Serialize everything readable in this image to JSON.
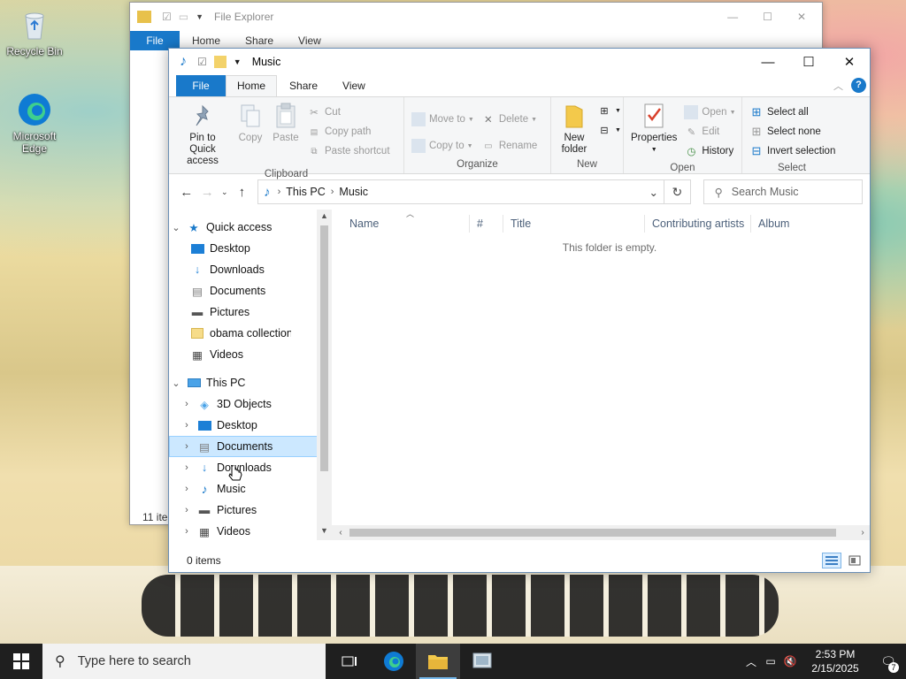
{
  "desktop": {
    "icons": [
      {
        "label": "Recycle Bin"
      },
      {
        "label": "Microsoft Edge"
      }
    ]
  },
  "back_window": {
    "title": "File Explorer",
    "tabs": [
      "File",
      "Home",
      "Share",
      "View"
    ],
    "status": "11 ite"
  },
  "window": {
    "title": "Music",
    "tabs": {
      "file": "File",
      "home": "Home",
      "share": "Share",
      "view": "View"
    },
    "ribbon": {
      "clipboard": {
        "label": "Clipboard",
        "pin": "Pin to Quick access",
        "copy": "Copy",
        "paste": "Paste",
        "cut": "Cut",
        "copy_path": "Copy path",
        "paste_shortcut": "Paste shortcut"
      },
      "organize": {
        "label": "Organize",
        "move_to": "Move to",
        "copy_to": "Copy to",
        "delete": "Delete",
        "rename": "Rename"
      },
      "new": {
        "label": "New",
        "new_folder": "New folder"
      },
      "open": {
        "label": "Open",
        "properties": "Properties",
        "open": "Open",
        "edit": "Edit",
        "history": "History"
      },
      "select": {
        "label": "Select",
        "select_all": "Select all",
        "select_none": "Select none",
        "invert": "Invert selection"
      }
    },
    "address": {
      "crumbs": [
        "This PC",
        "Music"
      ],
      "search_placeholder": "Search Music"
    },
    "nav": {
      "quick_access": "Quick access",
      "quick_items": [
        "Desktop",
        "Downloads",
        "Documents",
        "Pictures",
        "obama collection",
        "Videos"
      ],
      "this_pc": "This PC",
      "pc_items": [
        "3D Objects",
        "Desktop",
        "Documents",
        "Downloads",
        "Music",
        "Pictures",
        "Videos"
      ]
    },
    "columns": [
      "Name",
      "#",
      "Title",
      "Contributing artists",
      "Album"
    ],
    "empty_message": "This folder is empty.",
    "status": "0 items"
  },
  "taskbar": {
    "search_placeholder": "Type here to search",
    "time": "2:53 PM",
    "date": "2/15/2025",
    "notification_count": "7"
  },
  "colors": {
    "accent": "#1979ca",
    "selection": "#cce8ff",
    "taskbar": "#1f1f1f"
  }
}
